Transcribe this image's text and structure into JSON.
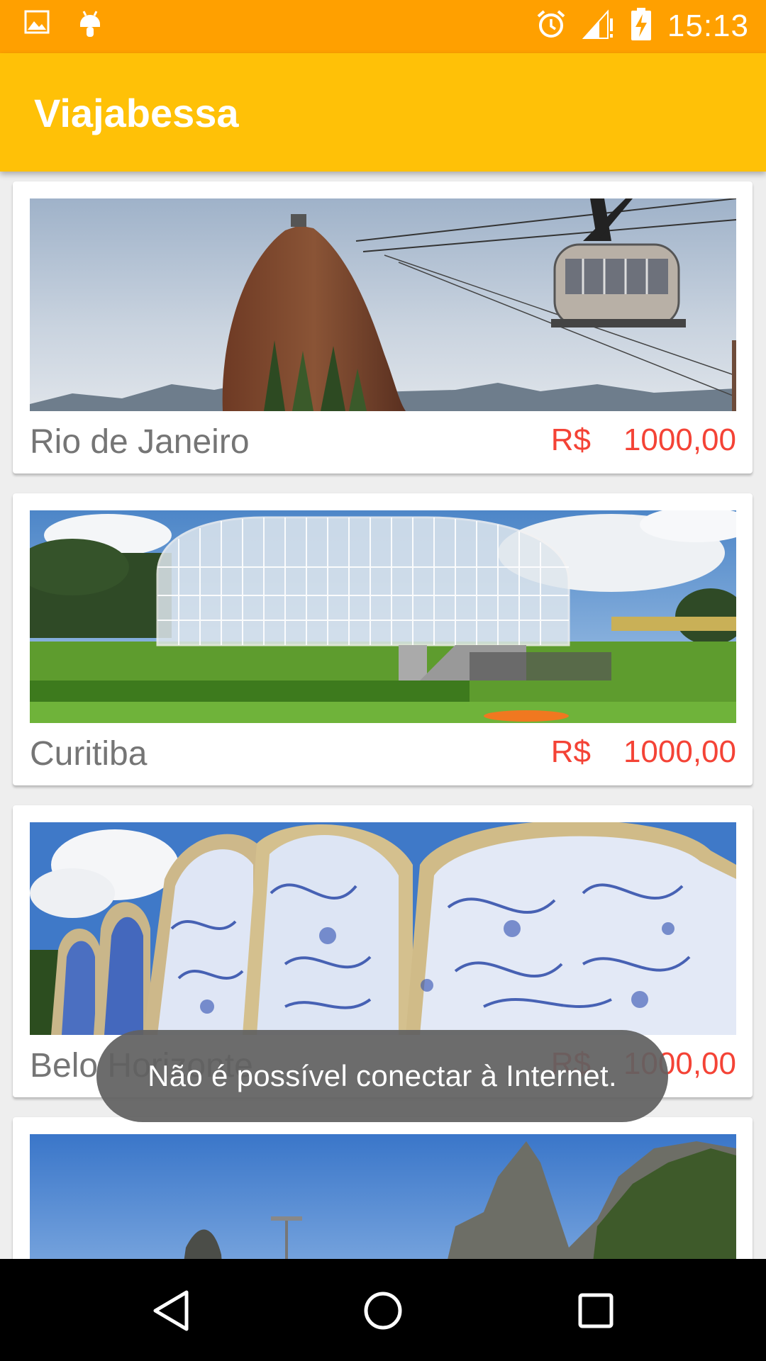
{
  "status_bar": {
    "time": "15:13",
    "left_icons": [
      "image-icon",
      "android-icon"
    ],
    "right_icons": [
      "alarm-icon",
      "signal-icon",
      "battery-charging-icon"
    ]
  },
  "app_bar": {
    "title": "Viajabessa",
    "color": "#ffc107",
    "status_color": "#ffa000"
  },
  "destinations": [
    {
      "name": "Rio de Janeiro",
      "currency": "R$",
      "price": "1000,00"
    },
    {
      "name": "Curitiba",
      "currency": "R$",
      "price": "1000,00"
    },
    {
      "name": "Belo Horizonte",
      "currency": "R$",
      "price": "1000,00"
    },
    {
      "name": "",
      "currency": "",
      "price": ""
    }
  ],
  "toast": {
    "message": "Não é possível conectar à Internet."
  },
  "nav_bar": {
    "buttons": [
      "back-icon",
      "home-icon",
      "recents-icon"
    ]
  },
  "colors": {
    "price": "#f44336",
    "name": "#757575"
  }
}
